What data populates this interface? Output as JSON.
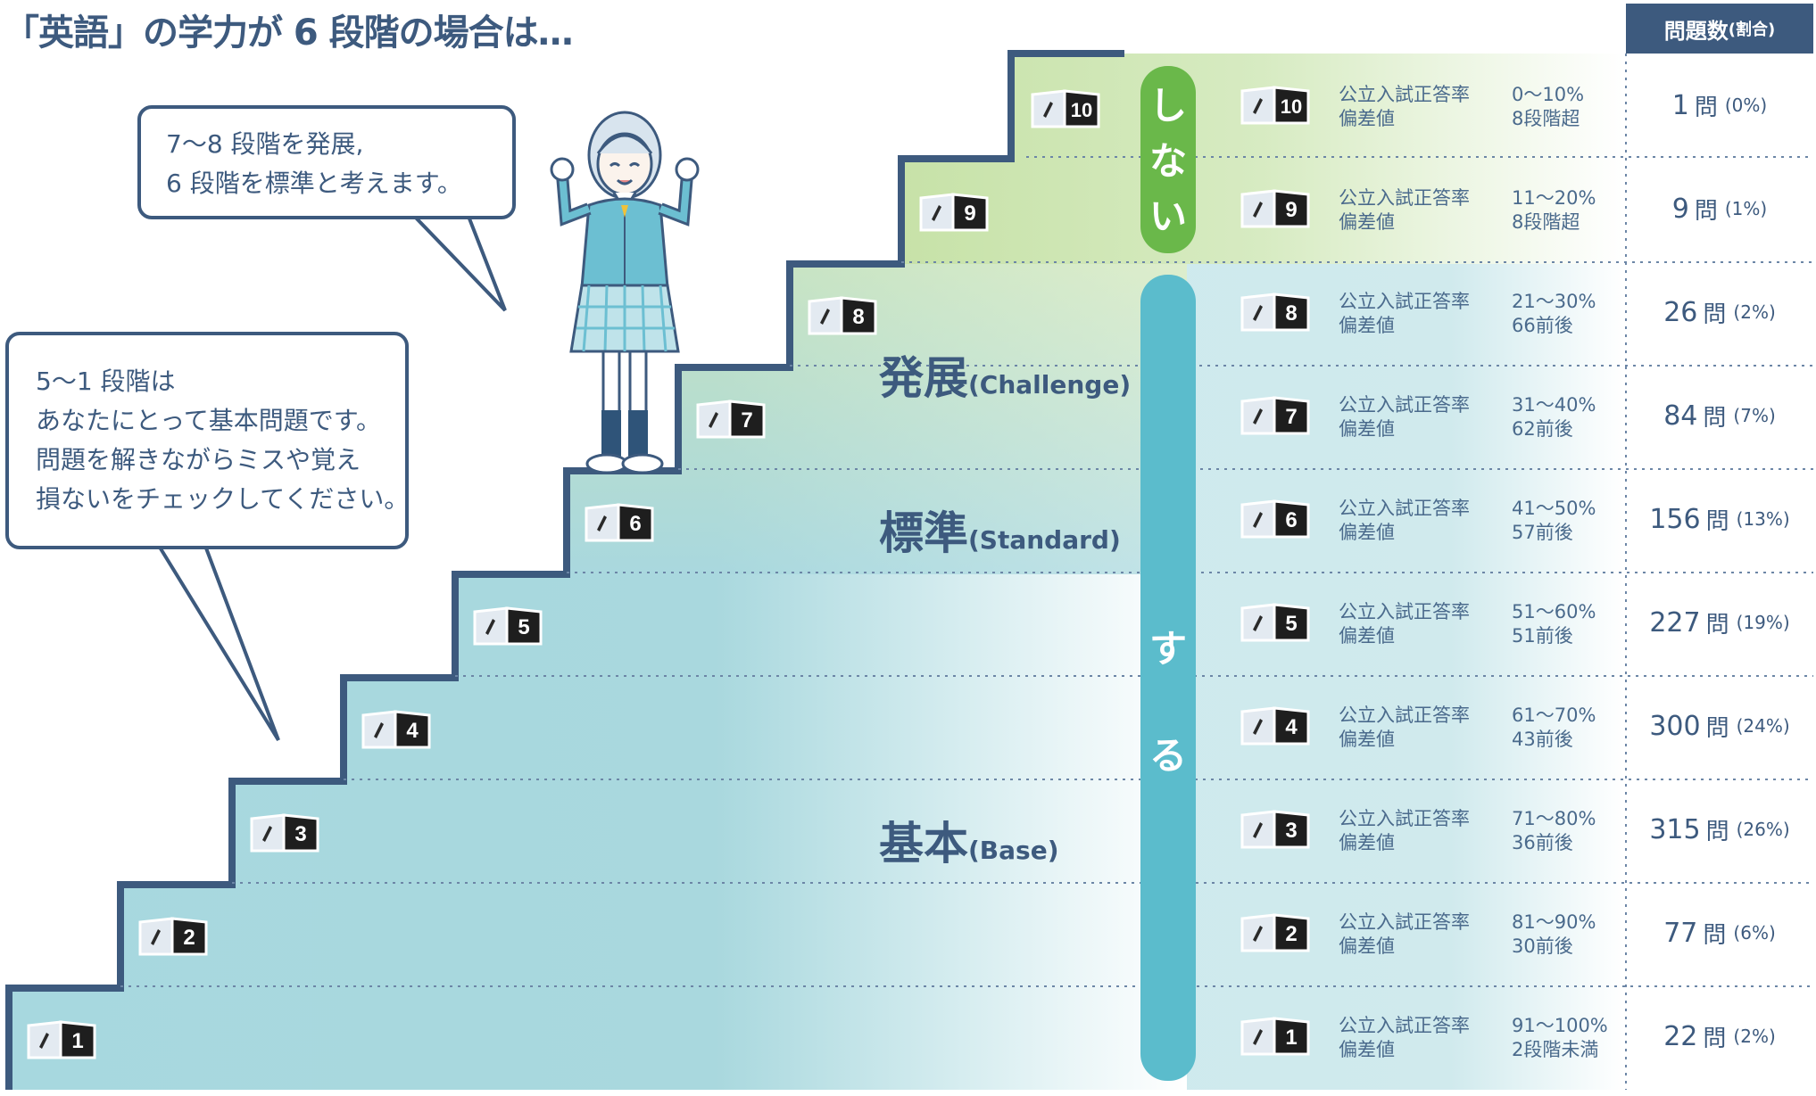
{
  "title": "「英語」の学力が 6 段階の場合は…",
  "table_header": {
    "main": "問題数",
    "sub": "(割合)"
  },
  "bubble_top": {
    "lines": [
      "7〜8 段階を発展,",
      "6 段階を標準と考えます。"
    ]
  },
  "bubble_left": {
    "lines": [
      "5〜1 段階は",
      "あなたにとって基本問題です。",
      "問題を解きながらミスや覚え",
      "損ないをチェックしてください。"
    ]
  },
  "zones": {
    "challenge": {
      "big": "発展",
      "sub": "(Challenge)"
    },
    "standard": {
      "big": "標準",
      "sub": "(Standard)"
    },
    "base": {
      "big": "基本",
      "sub": "(Base)"
    }
  },
  "pills": {
    "shinai": {
      "chars": [
        "し",
        "な",
        "い"
      ]
    },
    "suru": {
      "chars": [
        "す",
        "る"
      ]
    }
  },
  "colors": {
    "navy": "#3d5a7e",
    "green_pill": "#6ab84a",
    "teal_pill": "#5bbccc",
    "green_zone": "#cde4b4",
    "teal_zone": "#a9d8de"
  },
  "rows": [
    {
      "level": "10",
      "label1": "公立入試正答率",
      "label2": "偏差値",
      "rate": "0〜10%",
      "dev": "8段階超",
      "count": "1",
      "unit": "問",
      "pct": "(0%)"
    },
    {
      "level": "9",
      "label1": "公立入試正答率",
      "label2": "偏差値",
      "rate": "11〜20%",
      "dev": "8段階超",
      "count": "9",
      "unit": "問",
      "pct": "(1%)"
    },
    {
      "level": "8",
      "label1": "公立入試正答率",
      "label2": "偏差値",
      "rate": "21〜30%",
      "dev": "66前後",
      "count": "26",
      "unit": "問",
      "pct": "(2%)"
    },
    {
      "level": "7",
      "label1": "公立入試正答率",
      "label2": "偏差値",
      "rate": "31〜40%",
      "dev": "62前後",
      "count": "84",
      "unit": "問",
      "pct": "(7%)"
    },
    {
      "level": "6",
      "label1": "公立入試正答率",
      "label2": "偏差値",
      "rate": "41〜50%",
      "dev": "57前後",
      "count": "156",
      "unit": "問",
      "pct": "(13%)"
    },
    {
      "level": "5",
      "label1": "公立入試正答率",
      "label2": "偏差値",
      "rate": "51〜60%",
      "dev": "51前後",
      "count": "227",
      "unit": "問",
      "pct": "(19%)"
    },
    {
      "level": "4",
      "label1": "公立入試正答率",
      "label2": "偏差値",
      "rate": "61〜70%",
      "dev": "43前後",
      "count": "300",
      "unit": "問",
      "pct": "(24%)"
    },
    {
      "level": "3",
      "label1": "公立入試正答率",
      "label2": "偏差値",
      "rate": "71〜80%",
      "dev": "36前後",
      "count": "315",
      "unit": "問",
      "pct": "(26%)"
    },
    {
      "level": "2",
      "label1": "公立入試正答率",
      "label2": "偏差値",
      "rate": "81〜90%",
      "dev": "30前後",
      "count": "77",
      "unit": "問",
      "pct": "(6%)"
    },
    {
      "level": "1",
      "label1": "公立入試正答率",
      "label2": "偏差値",
      "rate": "91〜100%",
      "dev": "2段階未満",
      "count": "22",
      "unit": "問",
      "pct": "(2%)"
    }
  ]
}
